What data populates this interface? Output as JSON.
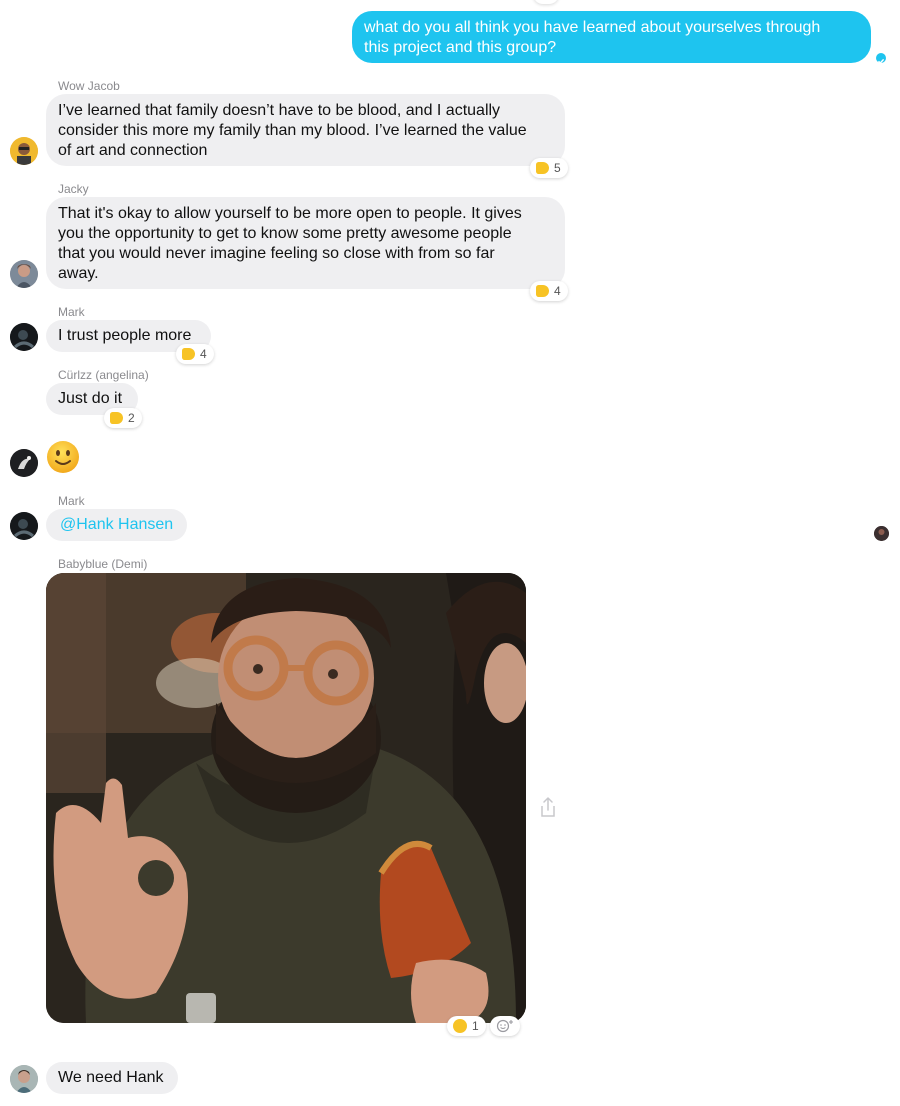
{
  "outgoing": {
    "text": "what do you all think you have learned about yourselves through\nthis project and this group?"
  },
  "messages": {
    "jacob": {
      "sender": "Wow Jacob",
      "text": "I’ve learned that family doesn’t have to be blood, and I actually\nconsider this more my family than my blood. I’ve learned the value\nof art and connection",
      "reaction_count": "5"
    },
    "jacky": {
      "sender": "Jacky",
      "text": "That it's okay to allow yourself to be more open to people. It gives\nyou the opportunity to get to know some pretty awesome people\nthat you would never imagine feeling so close with from so far\naway.",
      "reaction_count": "4"
    },
    "mark1": {
      "sender": "Mark",
      "text": "I trust people more",
      "reaction_count": "4"
    },
    "curlzz": {
      "sender": "Cürlzz (angelina)",
      "text": "Just do it",
      "reaction_count": "2"
    },
    "emoji_message": {
      "emoji": "slightly-smiling-face"
    },
    "mark2": {
      "sender": "Mark",
      "text": "@Hank Hansen"
    },
    "babyblue": {
      "sender": "Babyblue (Demi)",
      "photo_description": "photo",
      "reaction_count": "1"
    },
    "last": {
      "text": "We need Hank"
    }
  },
  "colors": {
    "accent": "#1ec4ef",
    "incoming_bubble": "#efeff1",
    "sender_name": "#8a8a8e",
    "reaction_emoji": "#f7c325"
  },
  "icons": {
    "thumbs_up": "thumbs-up-icon",
    "heart_eyes": "heart-eyes-icon",
    "add_reaction": "add-reaction-icon",
    "share": "share-icon",
    "seen": "seen-check-icon"
  }
}
